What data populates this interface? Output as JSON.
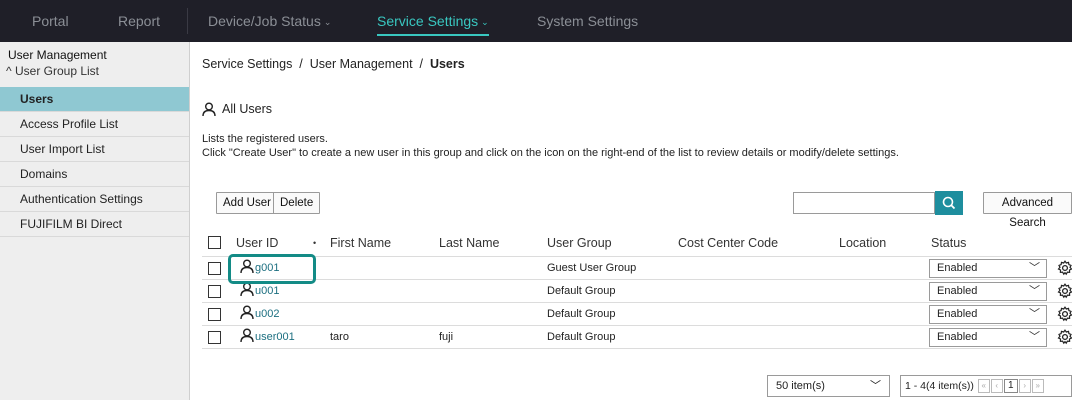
{
  "topnav": {
    "portal": "Portal",
    "report": "Report",
    "device_job_status": "Device/Job Status",
    "service_settings": "Service Settings",
    "system_settings": "System Settings"
  },
  "sidebar": {
    "header": "User Management",
    "group": "User Group List",
    "items": [
      {
        "label": "Users",
        "active": true
      },
      {
        "label": "Access Profile List"
      },
      {
        "label": "User Import List"
      },
      {
        "label": "Domains"
      },
      {
        "label": "Authentication Settings"
      },
      {
        "label": "FUJIFILM BI Direct"
      }
    ]
  },
  "breadcrumb": {
    "part1": "Service Settings",
    "sep": "/",
    "part2": "User Management",
    "current": "Users"
  },
  "section_title": "All Users",
  "description": {
    "line1": "Lists the registered users.",
    "line2": "Click \"Create User\" to create a new user in this group and click on the icon on the right-end of the list to review details or modify/delete settings."
  },
  "toolbar": {
    "add_user": "Add User",
    "delete": "Delete",
    "search_value": "",
    "advanced_search": "Advanced Search"
  },
  "table": {
    "headers": {
      "user_id": "User ID",
      "sort_marker": "•",
      "first_name": "First Name",
      "last_name": "Last Name",
      "user_group": "User Group",
      "cost_center_code": "Cost Center Code",
      "location": "Location",
      "status": "Status"
    },
    "rows": [
      {
        "user_id": "g001",
        "first_name": "",
        "last_name": "",
        "user_group": "Guest User Group",
        "cost_center_code": "",
        "location": "",
        "status": "Enabled"
      },
      {
        "user_id": "u001",
        "first_name": "",
        "last_name": "",
        "user_group": "Default Group",
        "cost_center_code": "",
        "location": "",
        "status": "Enabled"
      },
      {
        "user_id": "u002",
        "first_name": "",
        "last_name": "",
        "user_group": "Default Group",
        "cost_center_code": "",
        "location": "",
        "status": "Enabled"
      },
      {
        "user_id": "user001",
        "first_name": "taro",
        "last_name": "fuji",
        "user_group": "Default Group",
        "cost_center_code": "",
        "location": "",
        "status": "Enabled"
      }
    ]
  },
  "pagination": {
    "per_page": "50 item(s)",
    "range": "1 - 4(4 item(s))",
    "current_page": "1"
  },
  "colors": {
    "topbar_bg": "#1f1f28",
    "accent": "#39c7c0",
    "sidebar_active": "#8fc8d2",
    "search_button": "#1e8e9e",
    "link": "#1c6f80",
    "highlight": "#138b86"
  }
}
